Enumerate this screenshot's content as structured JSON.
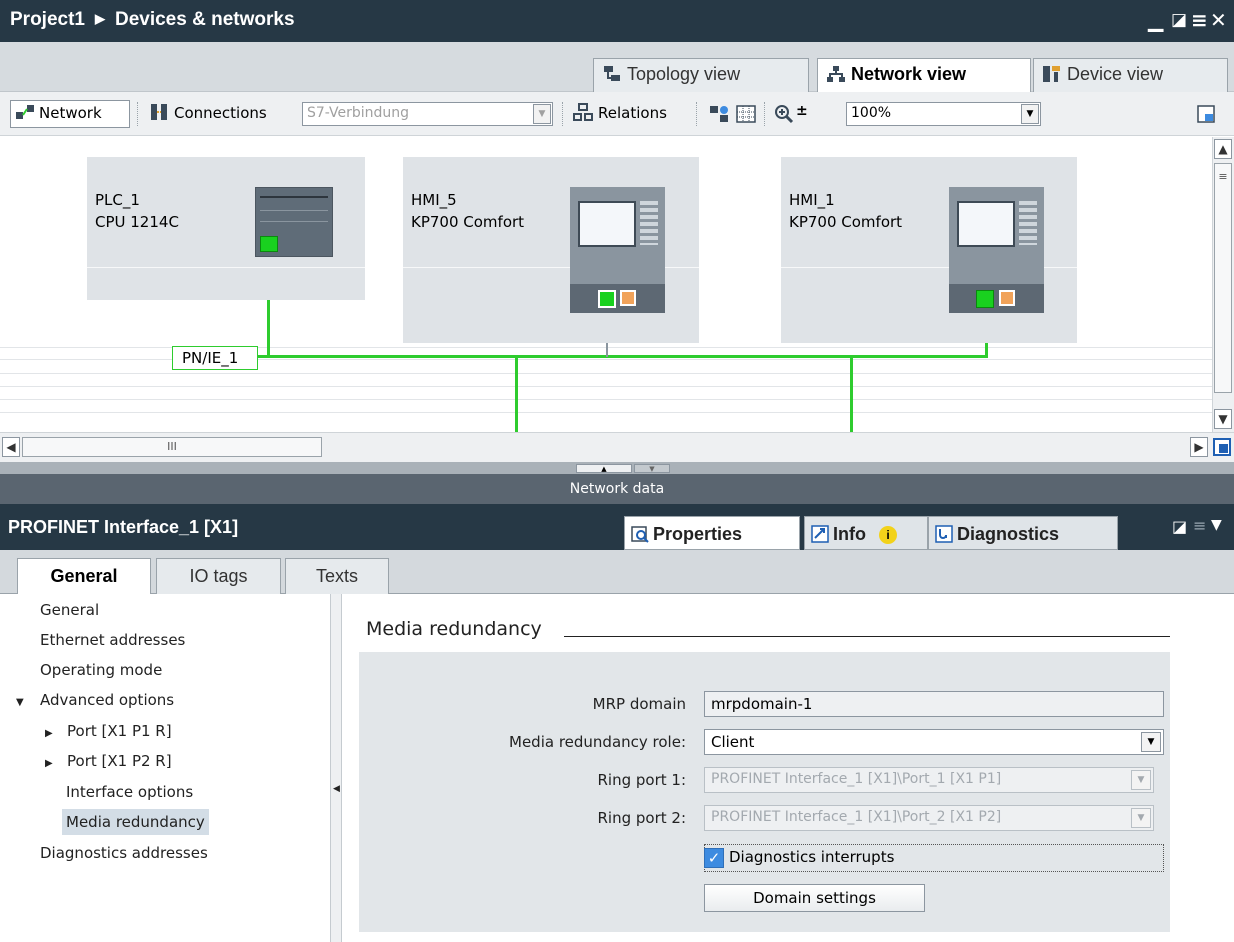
{
  "window": {
    "project": "Project1",
    "section": "Devices & networks"
  },
  "view_tabs": {
    "topology": "Topology view",
    "network": "Network view",
    "device": "Device view"
  },
  "toolbar": {
    "network_label": "Network",
    "connections_label": "Connections",
    "connection_type": "S7-Verbindung",
    "relations_label": "Relations",
    "zoom": "100%"
  },
  "canvas": {
    "devices": [
      {
        "name": "PLC_1",
        "type": "CPU 1214C"
      },
      {
        "name": "HMI_5",
        "type": "KP700 Comfort"
      },
      {
        "name": "HMI_1",
        "type": "KP700 Comfort"
      }
    ],
    "subnet_label": "PN/IE_1",
    "scroll_thumb": "III"
  },
  "splitter": {
    "network_data_label": "Network data"
  },
  "inspector": {
    "title": "PROFINET Interface_1 [X1]",
    "tabs": {
      "properties": "Properties",
      "info": "Info",
      "diagnostics": "Diagnostics"
    },
    "subtabs": [
      "General",
      "IO tags",
      "Texts"
    ]
  },
  "nav": {
    "items": [
      {
        "label": "General"
      },
      {
        "label": "Ethernet addresses"
      },
      {
        "label": "Operating mode"
      },
      {
        "label": "Advanced options"
      },
      {
        "label": "Port [X1 P1 R]"
      },
      {
        "label": "Port [X1 P2 R]"
      },
      {
        "label": "Interface options"
      },
      {
        "label": "Media redundancy"
      },
      {
        "label": "Diagnostics addresses"
      }
    ]
  },
  "media_redundancy": {
    "section_title": "Media redundancy",
    "mrp_domain_label": "MRP domain",
    "mrp_domain_value": "mrpdomain-1",
    "role_label": "Media redundancy role:",
    "role_value": "Client",
    "ring_port1_label": "Ring port 1:",
    "ring_port1_value": "PROFINET Interface_1 [X1]\\Port_1 [X1 P1]",
    "ring_port2_label": "Ring port 2:",
    "ring_port2_value": "PROFINET Interface_1 [X1]\\Port_2 [X1 P2]",
    "diag_interrupts_label": "Diagnostics interrupts",
    "diag_interrupts_checked": true,
    "domain_settings_label": "Domain settings"
  },
  "colors": {
    "titlebar": "#263845",
    "network_line": "#2ecc2e",
    "port_active": "#19d11f",
    "port_inactive": "#f1a35a",
    "checkbox": "#3d8be0"
  }
}
